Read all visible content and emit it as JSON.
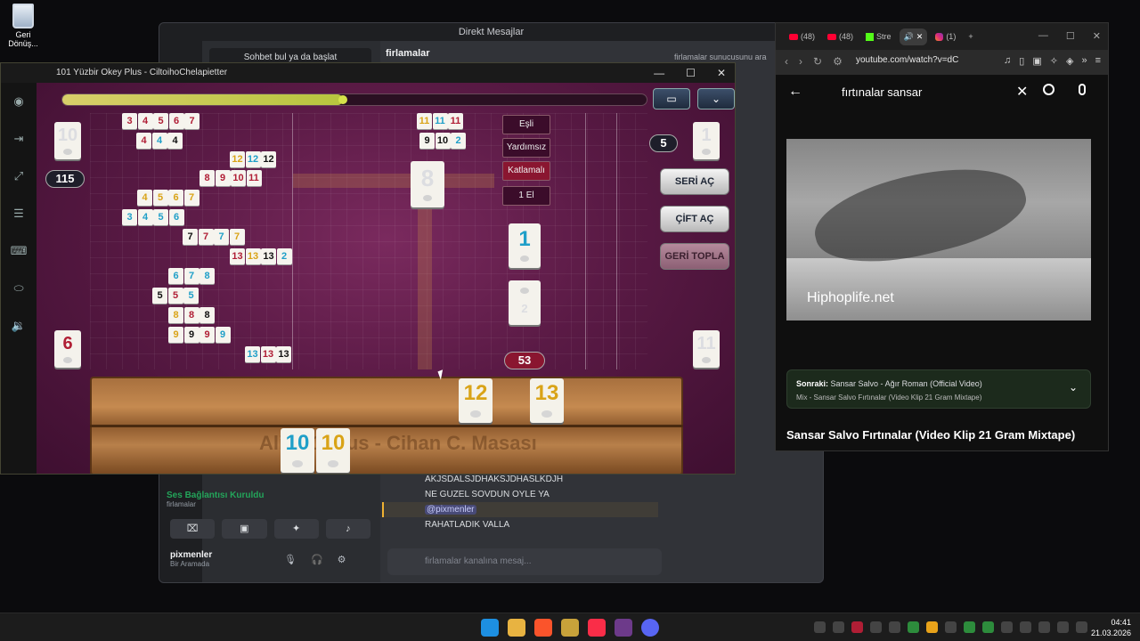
{
  "desktop": {
    "recycle_label": "Geri Dönüş..."
  },
  "discord": {
    "title": "Direkt Mesajlar",
    "search": "Sohbet bul ya da başlat",
    "channel": "firlamalar",
    "server_search": "firlamalar sunucusunu ara",
    "voice_status": "Ses Bağlantısı Kuruldu",
    "voice_channel": "firlamalar",
    "username": "pixmenler",
    "user_status": "Bir Aramada",
    "messages": [
      "AKJSDALSJDHAKSJDHASLKDJH",
      "NE GUZEL SOVDUN OYLE YA",
      "@pixmenler",
      "RAHATLADIK VALLA"
    ],
    "composer_placeholder": "firlamalar kanalına mesaj..."
  },
  "browser": {
    "tabs": [
      {
        "label": "(48)",
        "icon": "youtube-icon"
      },
      {
        "label": "(48)",
        "icon": "youtube-icon"
      },
      {
        "label": "Stre",
        "icon": "kick-icon"
      },
      {
        "label": "",
        "icon": "audio-icon"
      },
      {
        "label": "(1)",
        "icon": "instagram-icon"
      }
    ],
    "url": "youtube.com/watch?v=dC",
    "search_query": "fırtınalar sansar",
    "video_watermark": "Hiphoplife.net",
    "next_label": "Sonraki:",
    "next_title": "Sansar Salvo - Ağır Roman (Official Video)",
    "mix_label": "Mix - Sansar Salvo Fırtınalar (Video Klip 21 Gram Mixtape)",
    "video_title": "Sansar Salvo Fırtınalar (Video Klip 21 Gram Mixtape)"
  },
  "game": {
    "title": "101 Yüzbir Okey Plus - CiltoihoChelapietter",
    "timer_progress": 0.48,
    "opponent_left_top": "10",
    "score_left": "115",
    "opponent_left_bottom": "6",
    "opponent_right_top": "1",
    "opponent_right_count": "5",
    "opponent_right_bottom": "11",
    "center_tile": "8",
    "options": [
      "Eşli",
      "Yardımsız",
      "Katlamalı",
      "1 El"
    ],
    "indicator_tile": "1",
    "discard_tile": "2",
    "deck_count": "53",
    "buttons": {
      "seri": "SERİ AÇ",
      "cift": "ÇİFT AÇ",
      "geri": "GERİ TOPLA"
    },
    "rack_watermark": "Ali 101 Plus - Cihan C. Masası",
    "rack_top": [
      {
        "n": "12",
        "c": "y"
      },
      {
        "n": "13",
        "c": "y"
      }
    ],
    "rack_bottom": [
      {
        "n": "10",
        "c": "b"
      },
      {
        "n": "10",
        "c": "y"
      }
    ],
    "sets": [
      [
        {
          "n": "3",
          "c": "r"
        },
        {
          "n": "4",
          "c": "r"
        },
        {
          "n": "5",
          "c": "r"
        },
        {
          "n": "6",
          "c": "r"
        },
        {
          "n": "7",
          "c": "r"
        }
      ],
      [
        {
          "n": "4",
          "c": "r"
        },
        {
          "n": "4",
          "c": "b"
        },
        {
          "n": "4",
          "c": "k"
        }
      ],
      [
        {
          "n": "12",
          "c": "y"
        },
        {
          "n": "12",
          "c": "b"
        },
        {
          "n": "12",
          "c": "k"
        }
      ],
      [
        {
          "n": "8",
          "c": "r"
        },
        {
          "n": "9",
          "c": "r"
        },
        {
          "n": "10",
          "c": "r"
        },
        {
          "n": "11",
          "c": "r"
        }
      ],
      [
        {
          "n": "4",
          "c": "y"
        },
        {
          "n": "5",
          "c": "y"
        },
        {
          "n": "6",
          "c": "y"
        },
        {
          "n": "7",
          "c": "y"
        }
      ],
      [
        {
          "n": "3",
          "c": "b"
        },
        {
          "n": "4",
          "c": "b"
        },
        {
          "n": "5",
          "c": "b"
        },
        {
          "n": "6",
          "c": "b"
        }
      ],
      [
        {
          "n": "7",
          "c": "k"
        },
        {
          "n": "7",
          "c": "r"
        },
        {
          "n": "7",
          "c": "b"
        },
        {
          "n": "7",
          "c": "y"
        }
      ],
      [
        {
          "n": "13",
          "c": "r"
        },
        {
          "n": "13",
          "c": "y"
        },
        {
          "n": "13",
          "c": "k"
        },
        {
          "n": "2",
          "c": "b"
        }
      ],
      [
        {
          "n": "6",
          "c": "b"
        },
        {
          "n": "7",
          "c": "b"
        },
        {
          "n": "8",
          "c": "b"
        }
      ],
      [
        {
          "n": "5",
          "c": "k"
        },
        {
          "n": "5",
          "c": "r"
        },
        {
          "n": "5",
          "c": "b"
        }
      ],
      [
        {
          "n": "8",
          "c": "y"
        },
        {
          "n": "8",
          "c": "r"
        },
        {
          "n": "8",
          "c": "k"
        }
      ],
      [
        {
          "n": "9",
          "c": "y"
        },
        {
          "n": "9",
          "c": "k"
        },
        {
          "n": "9",
          "c": "r"
        },
        {
          "n": "9",
          "c": "b"
        }
      ],
      [
        {
          "n": "13",
          "c": "b"
        },
        {
          "n": "13",
          "c": "r"
        },
        {
          "n": "13",
          "c": "k"
        }
      ],
      [
        {
          "n": "11",
          "c": "y"
        },
        {
          "n": "11",
          "c": "b"
        },
        {
          "n": "11",
          "c": "r"
        }
      ],
      [
        {
          "n": "9",
          "c": "k"
        },
        {
          "n": "10",
          "c": "k"
        },
        {
          "n": "2",
          "c": "b"
        }
      ]
    ]
  },
  "taskbar": {
    "time": "04:41",
    "date": "21.03.2026"
  }
}
